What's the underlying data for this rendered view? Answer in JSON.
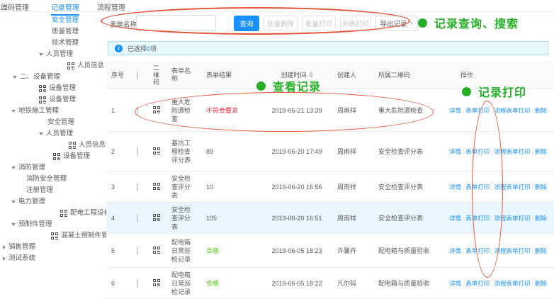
{
  "tabs": [
    {
      "label": "二维码管理",
      "active": false
    },
    {
      "label": "记录管理",
      "active": true
    },
    {
      "label": "流程管理",
      "active": false
    }
  ],
  "sidebar": {
    "items": [
      {
        "label": "安全管理",
        "indent": 73,
        "arrow": null,
        "icon": false,
        "active": true
      },
      {
        "label": "质量管理",
        "indent": 73,
        "arrow": null,
        "icon": false,
        "active": false
      },
      {
        "label": "技术管理",
        "indent": 73,
        "arrow": null,
        "icon": false,
        "active": false
      },
      {
        "label": "人员管理",
        "indent": 55,
        "arrow": "down",
        "icon": false,
        "active": false
      },
      {
        "label": "人员信息",
        "indent": 95,
        "arrow": null,
        "icon": true,
        "active": false
      },
      {
        "label": "二、设备管理",
        "indent": 18,
        "arrow": "down",
        "icon": false,
        "active": false
      },
      {
        "label": "设备管理",
        "indent": 55,
        "arrow": null,
        "icon": true,
        "active": false
      },
      {
        "label": "设备管理",
        "indent": 55,
        "arrow": null,
        "icon": true,
        "active": false
      },
      {
        "label": "地铁施工管理",
        "indent": 16,
        "arrow": "down",
        "icon": false,
        "active": false
      },
      {
        "label": "安全管理",
        "indent": 67,
        "arrow": null,
        "icon": false,
        "active": false
      },
      {
        "label": "人员管理",
        "indent": 55,
        "arrow": "down",
        "icon": false,
        "active": false
      },
      {
        "label": "人员信息管理",
        "indent": 97,
        "arrow": null,
        "icon": true,
        "active": false
      },
      {
        "label": "设备管理",
        "indent": 75,
        "arrow": null,
        "icon": true,
        "active": false
      },
      {
        "label": "消防管理",
        "indent": 16,
        "arrow": "down",
        "icon": false,
        "active": false
      },
      {
        "label": "消防安全管理",
        "indent": 37,
        "arrow": null,
        "icon": false,
        "active": false
      },
      {
        "label": "注册管理",
        "indent": 37,
        "arrow": null,
        "icon": false,
        "active": false
      },
      {
        "label": "电力管理",
        "indent": 16,
        "arrow": "down",
        "icon": false,
        "active": false
      },
      {
        "label": "配电工程设备巡检",
        "indent": 85,
        "arrow": null,
        "icon": true,
        "active": false
      },
      {
        "label": "预制件管理",
        "indent": 16,
        "arrow": "down",
        "icon": false,
        "active": false
      },
      {
        "label": "混凝土预制件管理",
        "indent": 72,
        "arrow": null,
        "icon": true,
        "active": false
      },
      {
        "label": "销售管理",
        "indent": 4,
        "arrow": "right",
        "icon": false,
        "active": false
      },
      {
        "label": "测试系统",
        "indent": 4,
        "arrow": "right",
        "icon": false,
        "active": false
      }
    ]
  },
  "toolbar": {
    "search_label": "表单名称:",
    "search_value": "",
    "query_button": "查询",
    "batch_delete_button": "批量删除",
    "batch_print_button": "批量打印",
    "list_print_button": "列表打印",
    "export_button": "导出记录",
    "export_chevron": "∨"
  },
  "alert": {
    "text_before": "已选择",
    "count": "0",
    "text_after": "项"
  },
  "table": {
    "headers": {
      "seq": "序号",
      "qr": "二维码",
      "name": "表单名称",
      "result": "表单结果",
      "created": "创建时间",
      "creator": "创建人",
      "qr_owner": "所属二维码",
      "actions": "操作"
    },
    "action_labels": {
      "detail": "详情",
      "form_print": "表单打印",
      "flow_print": "流程表单打印",
      "delete": "删除"
    },
    "rows": [
      {
        "seq": "1",
        "name": "重大危险源检查",
        "result": "不符合要求",
        "result_type": "fail",
        "created": "2019-06-21 13:39",
        "creator": "周雨祥",
        "qr_owner": "重大危险源检查"
      },
      {
        "seq": "2",
        "name": "基坑工程检查评分表",
        "result": "89",
        "result_type": "score",
        "created": "2019-06-20 17:49",
        "creator": "周雨祥",
        "qr_owner": "安全检查评分表"
      },
      {
        "seq": "3",
        "name": "安全检查评分表",
        "result": "10",
        "result_type": "score",
        "created": "2019-06-20 16:56",
        "creator": "周雨祥",
        "qr_owner": "安全检查评分表"
      },
      {
        "seq": "4",
        "name": "安全检查评分表",
        "result": "105",
        "result_type": "score",
        "created": "2019-06-20 16:51",
        "creator": "周雨祥",
        "qr_owner": "安全检查评分表"
      },
      {
        "seq": "5",
        "name": "配电箱日常巡检记录",
        "result": "合格",
        "result_type": "pass",
        "created": "2019-06-05 18:23",
        "creator": "许馨卉",
        "qr_owner": "配电箱与质量验收"
      },
      {
        "seq": "6",
        "name": "配电箱日常巡检记录",
        "result": "合格",
        "result_type": "pass",
        "created": "2019-06-05 18:22",
        "creator": "凡尔码",
        "qr_owner": "配电箱与质量验收"
      }
    ]
  },
  "annotations": {
    "search_note": "记录查询、搜索",
    "view_note": "查看记录",
    "print_note": "记录打印"
  },
  "colors": {
    "accent": "#1890ff",
    "annotation_green": "#27ae27",
    "annotation_red": "#e25237",
    "result_fail": "#f5222d",
    "result_pass": "#52c41a"
  }
}
